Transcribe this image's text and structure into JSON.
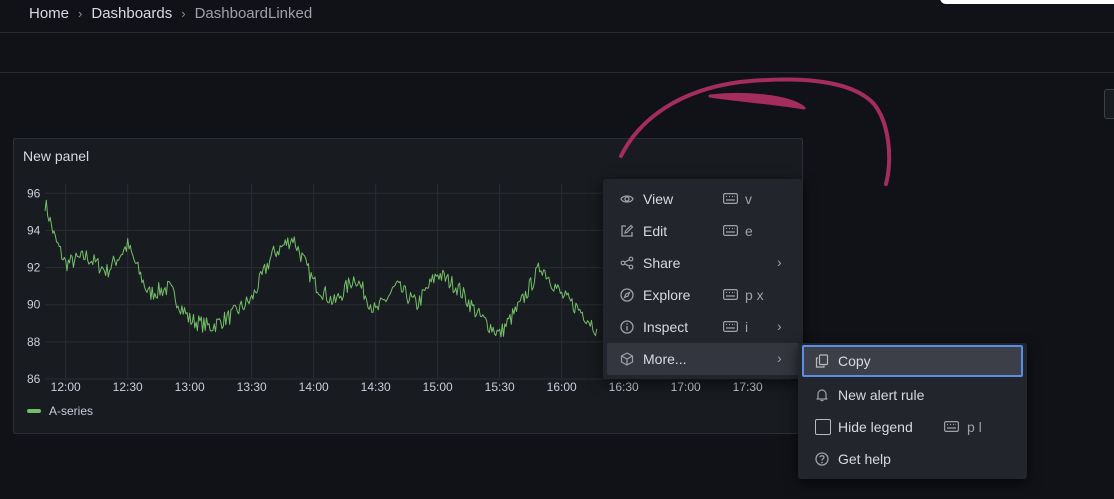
{
  "breadcrumb": {
    "home": "Home",
    "dashboards": "Dashboards",
    "current": "DashboardLinked",
    "separator": "›"
  },
  "panel": {
    "title": "New panel",
    "legend": "A-series"
  },
  "chart_data": {
    "type": "line",
    "x_ticks": [
      "12:00",
      "12:30",
      "13:00",
      "13:30",
      "14:00",
      "14:30",
      "15:00",
      "15:30",
      "16:00",
      "16:30",
      "17:00",
      "17:30"
    ],
    "y_ticks": [
      96,
      94,
      92,
      90,
      88,
      86
    ],
    "ylim": [
      86,
      96.5
    ],
    "grid": true,
    "legend": "bottom-left",
    "series": [
      {
        "name": "A-series",
        "color": "#73bf69",
        "x": [
          "11:50",
          "11:55",
          "12:00",
          "12:10",
          "12:20",
          "12:30",
          "12:40",
          "12:50",
          "13:00",
          "13:10",
          "13:20",
          "13:30",
          "13:40",
          "13:50",
          "14:00",
          "14:10",
          "14:20",
          "14:30",
          "14:40",
          "14:50",
          "15:00",
          "15:10",
          "15:20",
          "15:30",
          "15:40",
          "15:50",
          "16:00",
          "16:10",
          "16:17"
        ],
        "values": [
          95.5,
          93.5,
          92.2,
          92.6,
          91.8,
          93.2,
          90.6,
          90.9,
          89.2,
          88.8,
          89.4,
          90.3,
          92.7,
          93.6,
          91.2,
          90.1,
          91.5,
          89.6,
          91.0,
          90.0,
          91.7,
          90.9,
          89.4,
          88.4,
          90.0,
          92.1,
          90.5,
          89.6,
          88.7
        ]
      }
    ]
  },
  "context_menu": {
    "items": [
      {
        "label": "View",
        "icon": "eye-icon",
        "shortcut": "v",
        "submenu": false
      },
      {
        "label": "Edit",
        "icon": "edit-icon",
        "shortcut": "e",
        "submenu": false
      },
      {
        "label": "Share",
        "icon": "share-icon",
        "shortcut": "",
        "submenu": true
      },
      {
        "label": "Explore",
        "icon": "compass-icon",
        "shortcut": "p x",
        "submenu": false
      },
      {
        "label": "Inspect",
        "icon": "info-icon",
        "shortcut": "i",
        "submenu": true
      },
      {
        "label": "More...",
        "icon": "cube-icon",
        "shortcut": "",
        "submenu": true
      }
    ],
    "chevron": "›"
  },
  "sub_menu": {
    "items": [
      {
        "label": "Copy",
        "icon": "copy-icon",
        "shortcut": ""
      },
      {
        "label": "New alert rule",
        "icon": "bell-icon",
        "shortcut": ""
      },
      {
        "label": "Hide legend",
        "icon": "checkbox",
        "shortcut": "p l"
      },
      {
        "label": "Get help",
        "icon": "question-icon",
        "shortcut": ""
      }
    ]
  },
  "colors": {
    "background": "#111217",
    "panel": "#181b1f",
    "series": "#73bf69",
    "menu": "#22252b",
    "focus": "#5a8de5",
    "annotation": "#a52d5e"
  }
}
